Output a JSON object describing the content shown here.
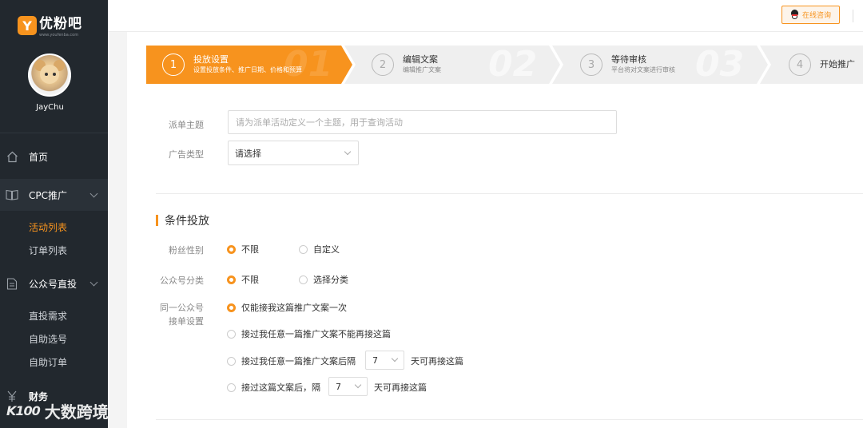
{
  "brand": {
    "name": "优粉吧",
    "sub": "www.youfenba.com",
    "mark": "Y"
  },
  "user": {
    "name": "JayChu"
  },
  "topbar": {
    "consult_label": "在线咨询"
  },
  "nav": {
    "home": "首页",
    "cpc": "CPC推广",
    "cpc_items": [
      "活动列表",
      "订单列表"
    ],
    "wechat": "公众号直投",
    "wechat_items": [
      "直投需求",
      "自助选号",
      "自助订单"
    ],
    "finance": "财务"
  },
  "steps": [
    {
      "num": "1",
      "title": "投放设置",
      "desc": "设置投放条件、推广日期、价格和预算",
      "big": "01"
    },
    {
      "num": "2",
      "title": "编辑文案",
      "desc": "编辑推广文案",
      "big": "02"
    },
    {
      "num": "3",
      "title": "等待审核",
      "desc": "平台将对文案进行审核",
      "big": "03"
    },
    {
      "num": "4",
      "title": "开始推广",
      "desc": ""
    }
  ],
  "form": {
    "subject_label": "派单主题",
    "subject_placeholder": "请为派单活动定义一个主题，用于查询活动",
    "adtype_label": "广告类型",
    "adtype_value": "请选择"
  },
  "conditions": {
    "title": "条件投放",
    "gender_label": "粉丝性别",
    "gender_options": [
      "不限",
      "自定义"
    ],
    "category_label": "公众号分类",
    "category_options": [
      "不限",
      "选择分类"
    ],
    "same_label_1": "同一公众号",
    "same_label_2": "接单设置",
    "same_options": [
      "仅能接我这篇推广文案一次",
      "接过我任意一篇推广文案不能再接这篇",
      "接过我任意一篇推广文案后隔",
      "接过这篇文案后，隔"
    ],
    "days_value_1": "7",
    "days_value_2": "7",
    "days_suffix": "天可再接这篇"
  },
  "watermark": {
    "logo": "K100",
    "text": "大数跨境"
  },
  "colors": {
    "accent": "#f7931e",
    "sidebar": "#22282e"
  }
}
